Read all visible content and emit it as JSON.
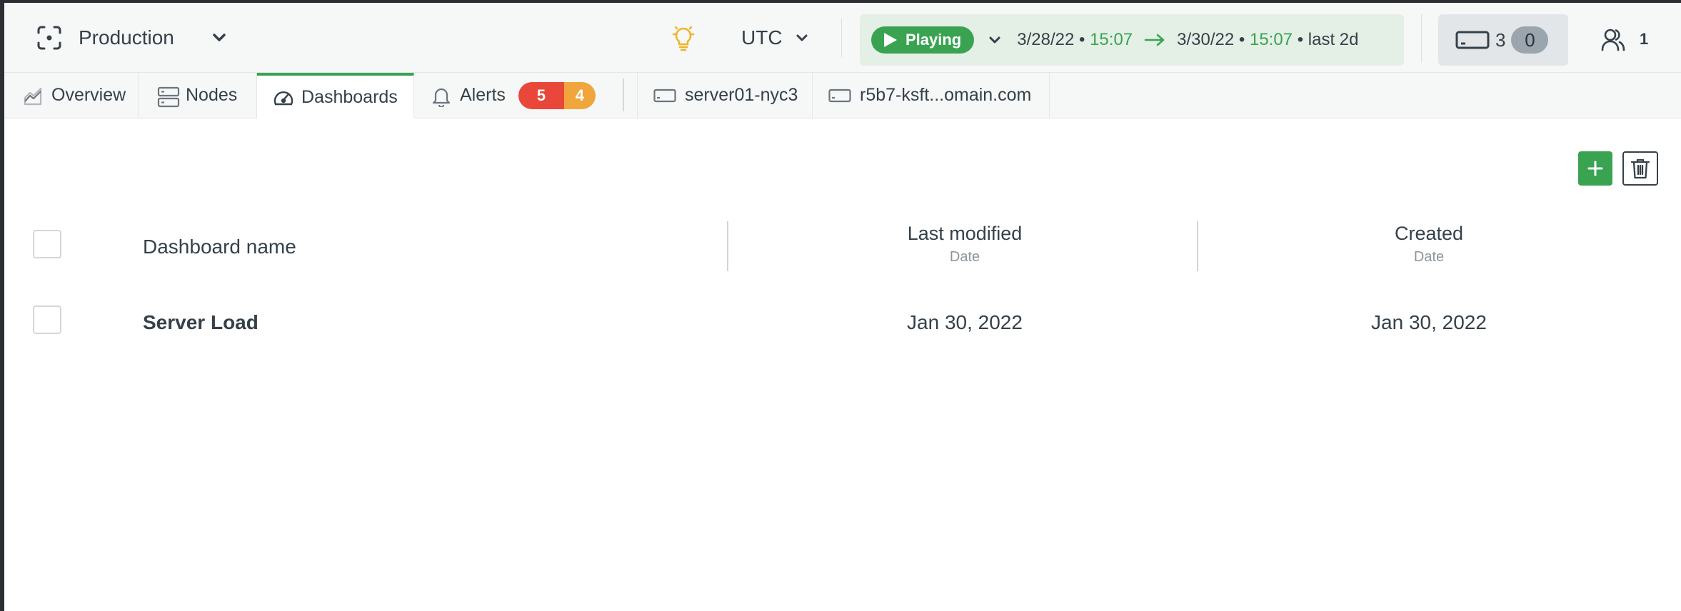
{
  "header": {
    "space_name": "Production",
    "timezone": "UTC",
    "play_label": "Playing",
    "range_start_date": "3/28/22",
    "range_start_time": "15:07",
    "range_end_date": "3/30/22",
    "range_end_time": "15:07",
    "range_period": "last 2d",
    "bullet": "•",
    "nodes_count": "3",
    "nodes_pill": "0",
    "members_count": "1"
  },
  "tabs": {
    "overview": "Overview",
    "nodes": "Nodes",
    "dashboards": "Dashboards",
    "alerts": "Alerts",
    "alerts_critical": "5",
    "alerts_warning": "4",
    "node1": "server01-nyc3",
    "node2": "r5b7-ksft...omain.com"
  },
  "table": {
    "columns": [
      {
        "title": "Dashboard name",
        "sub": ""
      },
      {
        "title": "Last modified",
        "sub": "Date"
      },
      {
        "title": "Created",
        "sub": "Date"
      }
    ],
    "rows": [
      {
        "name": "Server Load",
        "last_modified": "Jan 30, 2022",
        "created": "Jan 30, 2022"
      }
    ]
  },
  "colors": {
    "accent": "#3aa352",
    "critical": "#e8473a",
    "warning": "#f0a63c",
    "text": "#35414a"
  }
}
